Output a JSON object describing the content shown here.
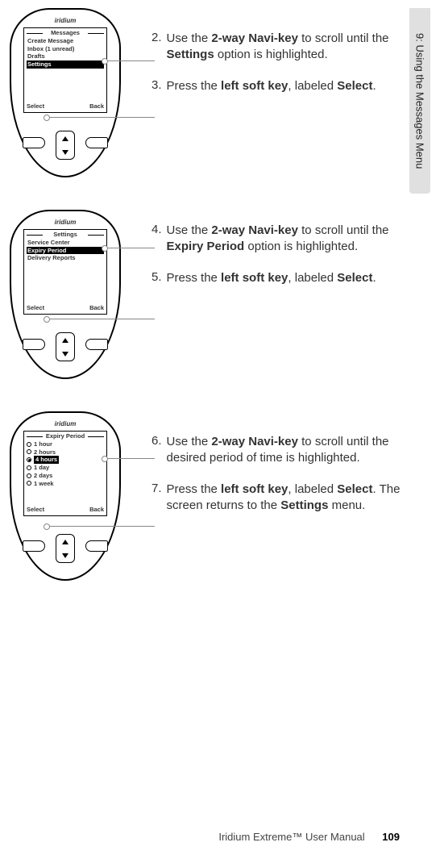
{
  "sideTab": "9: Using the Messages Menu",
  "logo": "iridium",
  "phones": [
    {
      "title": "Messages",
      "items": [
        {
          "label": "Create Message",
          "hl": false
        },
        {
          "label": "Inbox (1 unread)",
          "hl": false
        },
        {
          "label": "Drafts",
          "hl": false
        },
        {
          "label": "Settings",
          "hl": true
        }
      ],
      "softLeft": "Select",
      "softRight": "Back"
    },
    {
      "title": "Settings",
      "items": [
        {
          "label": "Service Center",
          "hl": false
        },
        {
          "label": "Expiry Period",
          "hl": true
        },
        {
          "label": "Delivery Reports",
          "hl": false
        }
      ],
      "softLeft": "Select",
      "softRight": "Back"
    },
    {
      "title": "Expiry Period",
      "radios": [
        {
          "label": "1 hour",
          "sel": false,
          "hl": false
        },
        {
          "label": "2 hours",
          "sel": false,
          "hl": false
        },
        {
          "label": "4 hours",
          "sel": true,
          "hl": true
        },
        {
          "label": "1 day",
          "sel": false,
          "hl": false
        },
        {
          "label": "2 days",
          "sel": false,
          "hl": false
        },
        {
          "label": "1 week",
          "sel": false,
          "hl": false
        }
      ],
      "softLeft": "Select",
      "softRight": "Back"
    }
  ],
  "steps": {
    "s2": {
      "n": "2.",
      "a": "Use the ",
      "b": "2-way Navi-key",
      "c": " to scroll until the ",
      "d": "Settings",
      "e": " option is highlighted."
    },
    "s3": {
      "n": "3.",
      "a": "Press the ",
      "b": "left soft key",
      "c": ", labeled ",
      "d": "Select",
      "e": "."
    },
    "s4": {
      "n": "4.",
      "a": "Use the ",
      "b": "2-way Navi-key",
      "c": " to scroll until the ",
      "d": "Expiry Period",
      "e": " option is highlighted."
    },
    "s5": {
      "n": "5.",
      "a": "Press the ",
      "b": "left soft key",
      "c": ", labeled ",
      "d": "Select",
      "e": "."
    },
    "s6": {
      "n": "6.",
      "a": "Use the ",
      "b": "2-way Navi-key",
      "c": " to scroll until the desired period of time is highlighted."
    },
    "s7": {
      "n": "7.",
      "a": "Press the ",
      "b": "left soft key",
      "c": ", labeled ",
      "d": "Select",
      "e": ". The screen returns to the ",
      "f": "Settings",
      "g": " menu."
    }
  },
  "footer": {
    "title": "Iridium Extreme™ User Manual",
    "page": "109"
  }
}
